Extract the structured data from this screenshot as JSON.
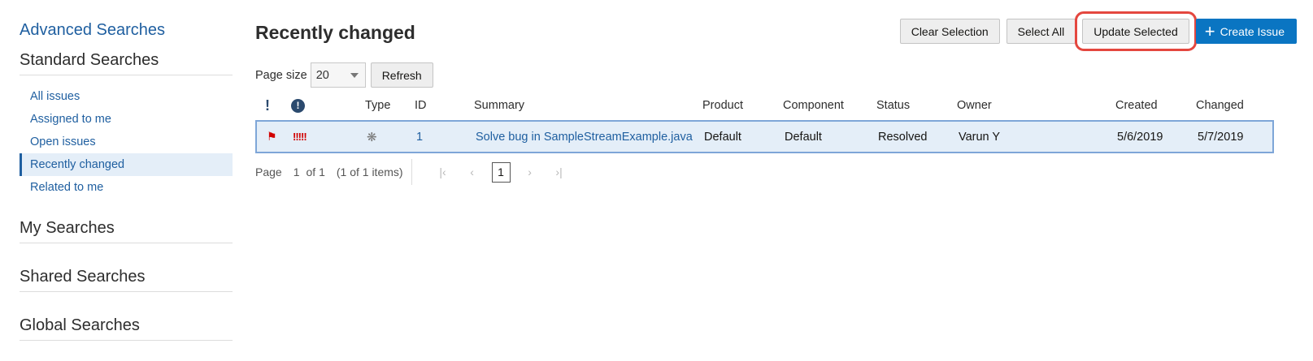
{
  "sidebar": {
    "advanced": "Advanced Searches",
    "standard_heading": "Standard Searches",
    "standard_items": [
      {
        "label": "All issues"
      },
      {
        "label": "Assigned to me"
      },
      {
        "label": "Open issues"
      },
      {
        "label": "Recently changed",
        "active": true
      },
      {
        "label": "Related to me"
      }
    ],
    "my_heading": "My Searches",
    "shared_heading": "Shared Searches",
    "global_heading": "Global Searches"
  },
  "main": {
    "title": "Recently changed",
    "toolbar": {
      "clear_selection": "Clear Selection",
      "select_all": "Select All",
      "update_selected": "Update Selected",
      "create_issue": "Create Issue"
    },
    "page_size_label": "Page size",
    "page_size_value": "20",
    "refresh": "Refresh"
  },
  "table": {
    "columns": {
      "flag": "!",
      "priority": "!",
      "type": "Type",
      "id": "ID",
      "summary": "Summary",
      "product": "Product",
      "component": "Component",
      "status": "Status",
      "owner": "Owner",
      "created": "Created",
      "changed": "Changed"
    },
    "rows": [
      {
        "flag_icon": "red-flag-icon",
        "priority_icon": "priority-critical-icon",
        "priority_glyph": "!!!!!",
        "type_icon": "bug-icon",
        "id": "1",
        "summary": "Solve bug in SampleStreamExample.java",
        "product": "Default",
        "component": "Default",
        "status": "Resolved",
        "owner": "Varun Y",
        "created": "5/6/2019",
        "changed": "5/7/2019"
      }
    ]
  },
  "pager": {
    "page_label": "Page",
    "current": "1",
    "of_total": "of 1",
    "items": "(1 of 1 items)",
    "page_button": "1"
  },
  "colors": {
    "accent": "#0a75c2",
    "link": "#1f5fa0",
    "highlight_box": "#e4473f",
    "selected_row": "#e4eef8"
  }
}
